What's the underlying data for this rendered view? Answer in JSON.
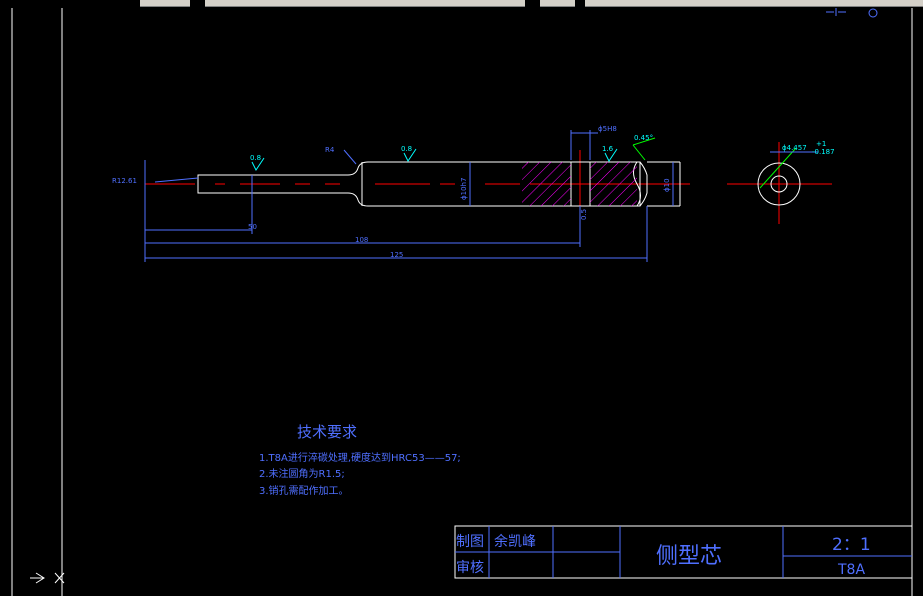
{
  "colors": {
    "background": "#000000",
    "border": "#ffffff",
    "outline": "#ffffff",
    "center_line": "#ff0000",
    "dimension": "#0000ff",
    "symbol": "#00ffff",
    "hatch": "#ff00ff",
    "leader": "#00ff00",
    "note": "#0000ff"
  },
  "icons": {
    "top_right_1": "crosshair-icon",
    "top_right_2": "circle-icon",
    "ucs": "ucs-arrow-icon"
  },
  "drawing": {
    "dims": {
      "r_left": "R12.61",
      "len_50": "50",
      "len_108": "108",
      "len_total": "125",
      "r4": "R4",
      "dia_h7": "ϕ10h7",
      "dia_10": "ϕ10",
      "hole": "ϕ5H8",
      "chamfer": "0.45°",
      "hole_dim": "ϕ4.457",
      "tol_plus": "+1",
      "tol_minus": "-0.187",
      "rough_1": "0.8",
      "rough_2": "0.8",
      "rough_3": "1.6",
      "small_label": "0.5"
    }
  },
  "notes": {
    "title": "技术要求",
    "lines": [
      "1.T8A进行淬碳处理,硬度达到HRC53——57;",
      "2.未注圆角为R1.5;",
      "3.销孔需配作加工。"
    ]
  },
  "title_block": {
    "drawn_label": "制图",
    "drawn_name": "余凯峰",
    "check_label": "审核",
    "part_name": "侧型芯",
    "scale": "2：1",
    "material": "T8A"
  }
}
